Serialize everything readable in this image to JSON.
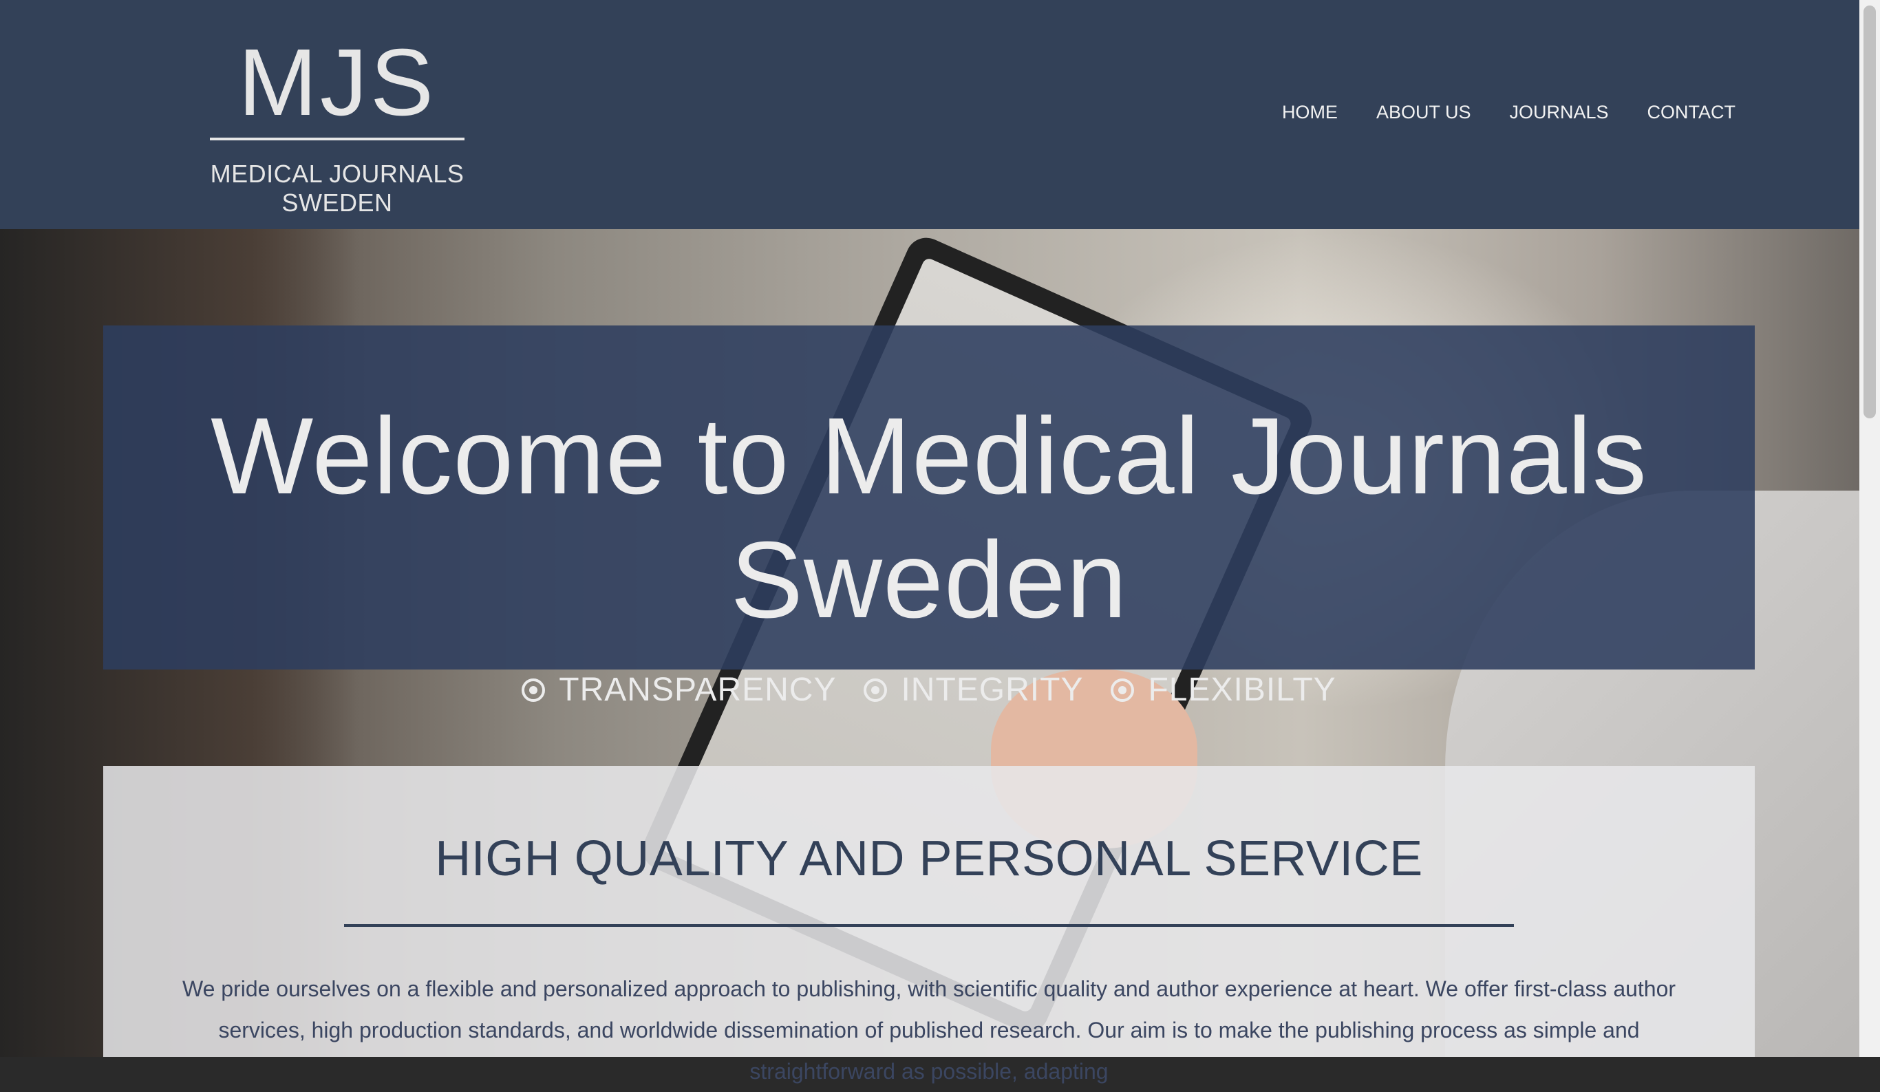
{
  "header": {
    "logo_mark": "MJS",
    "logo_subtitle": "MEDICAL JOURNALS SWEDEN",
    "nav": [
      "HOME",
      "ABOUT US",
      "JOURNALS",
      "CONTACT"
    ]
  },
  "welcome": {
    "title": "Welcome to Medical Journals Sweden",
    "values": [
      "TRANSPARENCY",
      "INTEGRITY",
      "FLEXIBILTY"
    ],
    "value_icon": "radio-dot-icon"
  },
  "service": {
    "title": "HIGH QUALITY AND PERSONAL SERVICE",
    "paragraph": "We pride ourselves on a flexible and personalized approach to publishing, with scientific quality and author experience at heart. We offer first-class author services, high production standards, and worldwide dissemination of published research. Our aim is to make the publishing process as simple and straightforward as possible, adapting"
  },
  "colors": {
    "header_bg": "#334158",
    "panel_bg": "#2e3e5e",
    "text_light": "#ececec"
  }
}
